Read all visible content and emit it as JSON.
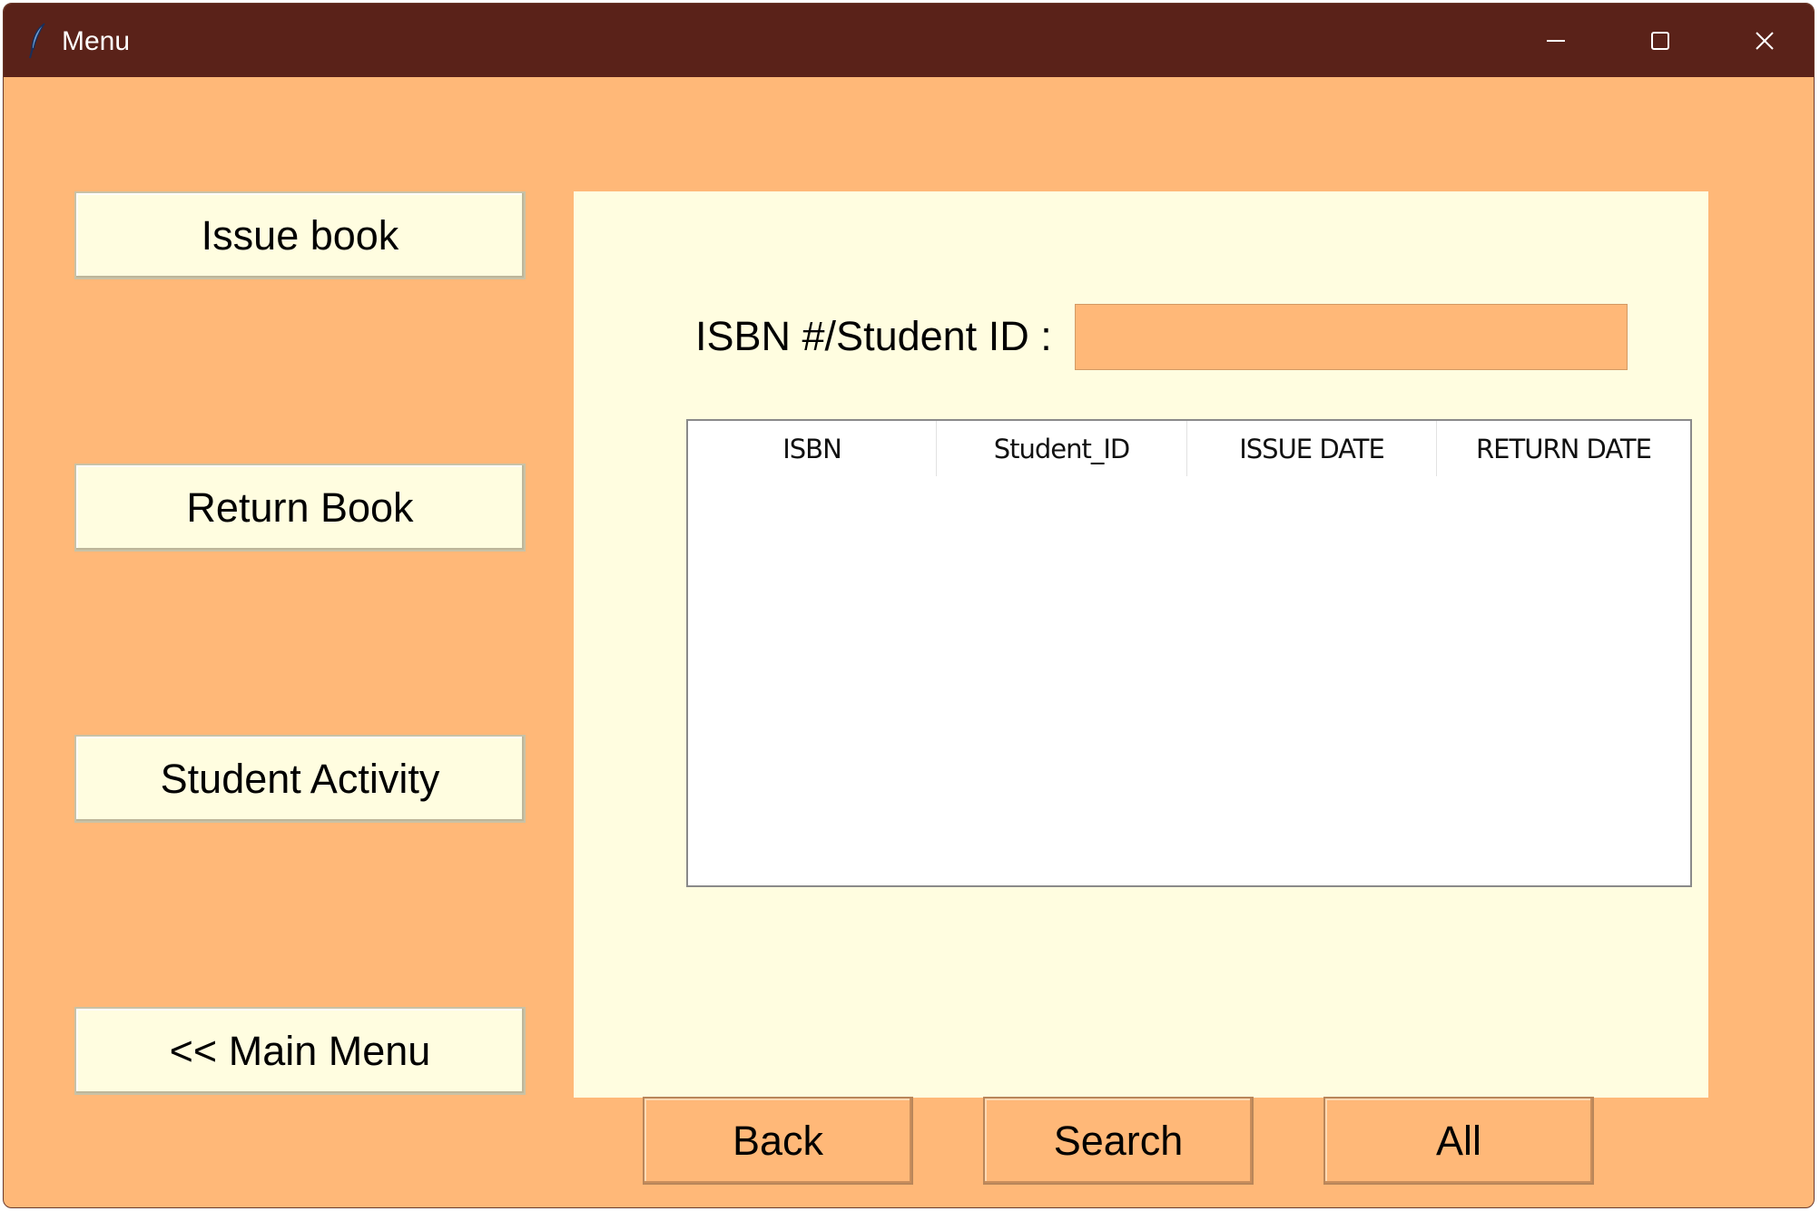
{
  "window": {
    "title": "Menu",
    "controls": {
      "minimize_icon": "minimize-icon",
      "maximize_icon": "maximize-icon",
      "close_icon": "close-icon"
    }
  },
  "sidebar": {
    "issue_book": "Issue book",
    "return_book": "Return Book",
    "student_activity": "Student Activity",
    "main_menu": "<< Main Menu"
  },
  "search": {
    "label": "ISBN #/Student ID :",
    "value": ""
  },
  "table": {
    "columns": [
      "ISBN",
      "Student_ID",
      "ISSUE DATE",
      "RETURN DATE"
    ],
    "rows": []
  },
  "actions": {
    "back": "Back",
    "search": "Search",
    "all": "All"
  },
  "colors": {
    "titlebar": "#5a2219",
    "background": "#ffb878",
    "panel": "#fffde0",
    "table_bg": "#ffffff"
  }
}
